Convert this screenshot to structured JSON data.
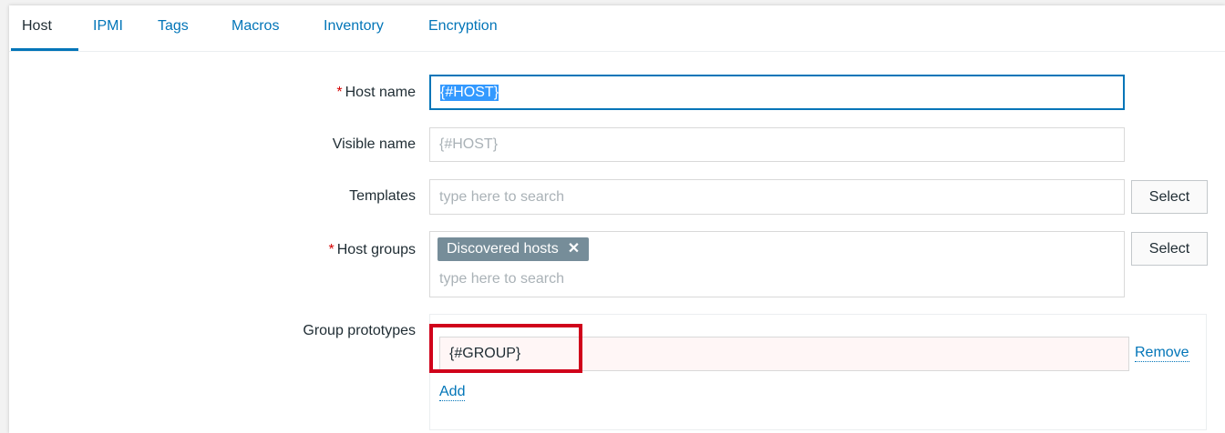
{
  "tabs": [
    {
      "label": "Host",
      "active": true
    },
    {
      "label": "IPMI",
      "active": false
    },
    {
      "label": "Tags",
      "active": false
    },
    {
      "label": "Macros",
      "active": false
    },
    {
      "label": "Inventory",
      "active": false
    },
    {
      "label": "Encryption",
      "active": false
    }
  ],
  "form": {
    "required_mark": "*",
    "host_name": {
      "label": "Host name",
      "value": "{#HOST}",
      "required": true,
      "text_selected": true
    },
    "visible_name": {
      "label": "Visible name",
      "placeholder": "{#HOST}"
    },
    "templates": {
      "label": "Templates",
      "placeholder": "type here to search",
      "select_label": "Select"
    },
    "host_groups": {
      "label": "Host groups",
      "required": true,
      "chips": [
        {
          "label": "Discovered hosts",
          "remove_glyph": "✕"
        }
      ],
      "placeholder": "type here to search",
      "select_label": "Select"
    },
    "group_prototypes": {
      "label": "Group prototypes",
      "rows": [
        {
          "value": "{#GROUP}",
          "remove_label": "Remove"
        }
      ],
      "add_label": "Add"
    }
  },
  "colors": {
    "accent": "#0275b8",
    "required": "#d40000",
    "highlight_frame": "#d0021b",
    "chip_bg": "#768d99",
    "selection_bg": "#3399ff"
  }
}
